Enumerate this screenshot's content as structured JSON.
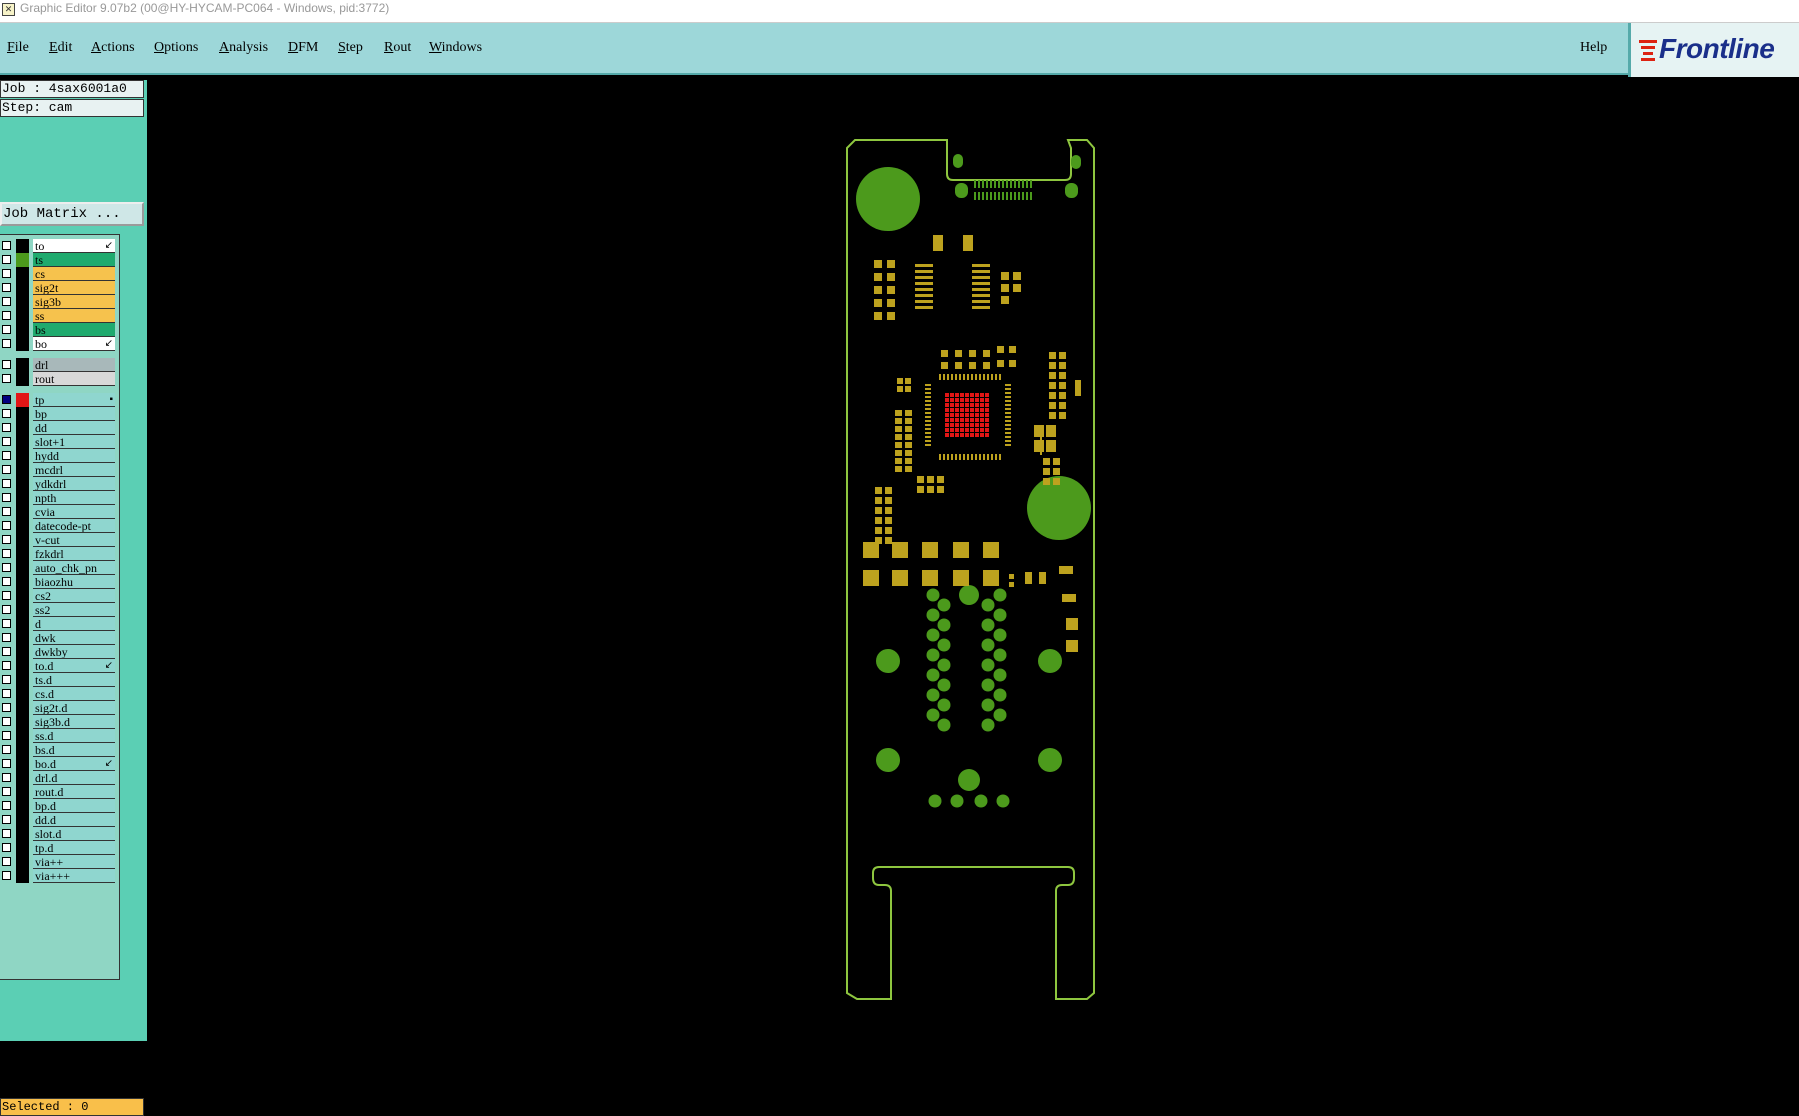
{
  "window": {
    "title": "Graphic Editor 9.07b2 (00@HY-HYCAM-PC064 - Windows, pid:3772)"
  },
  "menu": [
    {
      "label": "File",
      "u": "F",
      "rest": "ile"
    },
    {
      "label": "Edit",
      "u": "E",
      "rest": "dit"
    },
    {
      "label": "Actions",
      "u": "A",
      "rest": "ctions"
    },
    {
      "label": "Options",
      "u": "O",
      "rest": "ptions"
    },
    {
      "label": "Analysis",
      "u": "A",
      "rest": "nalysis"
    },
    {
      "label": "DFM",
      "u": "D",
      "rest": "FM"
    },
    {
      "label": "Step",
      "u": "S",
      "rest": "tep"
    },
    {
      "label": "Rout",
      "u": "R",
      "rest": "out"
    },
    {
      "label": "Windows",
      "u": "W",
      "rest": "indows"
    }
  ],
  "help": "Help",
  "logo": "Frontline",
  "info": {
    "job": "Job : 4sax6001a0",
    "step": "Step: cam"
  },
  "job_matrix_button": "Job Matrix ...",
  "selected": "Selected : 0",
  "colors": {
    "menu_bg": "#9dd7d9",
    "panel_bg": "#5bcfb4",
    "board_outline": "#8ec63f",
    "copper_green": "#4c9a1c",
    "pad_gold": "#bda21e",
    "red_layer": "#e21616"
  },
  "layers": [
    {
      "name": "to",
      "bg": "#ffffff",
      "swatch": "#000000",
      "mark": "↙"
    },
    {
      "name": "ts",
      "bg": "#1faa6e",
      "swatch": "#4c9a1c",
      "mark": ""
    },
    {
      "name": "cs",
      "bg": "#f6c24d",
      "swatch": "#000000",
      "mark": ""
    },
    {
      "name": "sig2t",
      "bg": "#f6c24d",
      "swatch": "#000000",
      "mark": ""
    },
    {
      "name": "sig3b",
      "bg": "#f6c24d",
      "swatch": "#000000",
      "mark": ""
    },
    {
      "name": "ss",
      "bg": "#f6c24d",
      "swatch": "#000000",
      "mark": ""
    },
    {
      "name": "bs",
      "bg": "#1faa6e",
      "swatch": "#000000",
      "mark": ""
    },
    {
      "name": "bo",
      "bg": "#ffffff",
      "swatch": "#000000",
      "mark": "↙"
    },
    {
      "name": "drl",
      "bg": "#a8b8ba",
      "swatch": "#000000",
      "mark": ""
    },
    {
      "name": "rout",
      "bg": "#d8d8d8",
      "swatch": "#000000",
      "mark": ""
    },
    {
      "name": "tp",
      "bg": "#8fd6cf",
      "swatch": "#e21616",
      "mark": "▪",
      "checked": true
    },
    {
      "name": "bp",
      "bg": "#8fd6cf",
      "swatch": "#000000",
      "mark": ""
    },
    {
      "name": "dd",
      "bg": "#8fd6cf",
      "swatch": "#000000",
      "mark": ""
    },
    {
      "name": "slot+1",
      "bg": "#8fd6cf",
      "swatch": "#000000",
      "mark": ""
    },
    {
      "name": "hydd",
      "bg": "#8fd6cf",
      "swatch": "#000000",
      "mark": ""
    },
    {
      "name": "mcdrl",
      "bg": "#8fd6cf",
      "swatch": "#000000",
      "mark": ""
    },
    {
      "name": "ydkdrl",
      "bg": "#8fd6cf",
      "swatch": "#000000",
      "mark": ""
    },
    {
      "name": "npth",
      "bg": "#8fd6cf",
      "swatch": "#000000",
      "mark": ""
    },
    {
      "name": "cvia",
      "bg": "#8fd6cf",
      "swatch": "#000000",
      "mark": ""
    },
    {
      "name": "datecode-pt",
      "bg": "#8fd6cf",
      "swatch": "#000000",
      "mark": ""
    },
    {
      "name": "v-cut",
      "bg": "#8fd6cf",
      "swatch": "#000000",
      "mark": ""
    },
    {
      "name": "fzkdrl",
      "bg": "#8fd6cf",
      "swatch": "#000000",
      "mark": ""
    },
    {
      "name": "auto_chk_pn",
      "bg": "#8fd6cf",
      "swatch": "#000000",
      "mark": ""
    },
    {
      "name": "biaozhu",
      "bg": "#8fd6cf",
      "swatch": "#000000",
      "mark": ""
    },
    {
      "name": "cs2",
      "bg": "#8fd6cf",
      "swatch": "#000000",
      "mark": ""
    },
    {
      "name": "ss2",
      "bg": "#8fd6cf",
      "swatch": "#000000",
      "mark": ""
    },
    {
      "name": "d",
      "bg": "#8fd6cf",
      "swatch": "#000000",
      "mark": ""
    },
    {
      "name": "dwk",
      "bg": "#8fd6cf",
      "swatch": "#000000",
      "mark": ""
    },
    {
      "name": "dwkby",
      "bg": "#8fd6cf",
      "swatch": "#000000",
      "mark": ""
    },
    {
      "name": "to.d",
      "bg": "#8fd6cf",
      "swatch": "#000000",
      "mark": "↙"
    },
    {
      "name": "ts.d",
      "bg": "#8fd6cf",
      "swatch": "#000000",
      "mark": ""
    },
    {
      "name": "cs.d",
      "bg": "#8fd6cf",
      "swatch": "#000000",
      "mark": ""
    },
    {
      "name": "sig2t.d",
      "bg": "#8fd6cf",
      "swatch": "#000000",
      "mark": ""
    },
    {
      "name": "sig3b.d",
      "bg": "#8fd6cf",
      "swatch": "#000000",
      "mark": ""
    },
    {
      "name": "ss.d",
      "bg": "#8fd6cf",
      "swatch": "#000000",
      "mark": ""
    },
    {
      "name": "bs.d",
      "bg": "#8fd6cf",
      "swatch": "#000000",
      "mark": ""
    },
    {
      "name": "bo.d",
      "bg": "#8fd6cf",
      "swatch": "#000000",
      "mark": "↙"
    },
    {
      "name": "drl.d",
      "bg": "#8fd6cf",
      "swatch": "#000000",
      "mark": ""
    },
    {
      "name": "rout.d",
      "bg": "#8fd6cf",
      "swatch": "#000000",
      "mark": ""
    },
    {
      "name": "bp.d",
      "bg": "#8fd6cf",
      "swatch": "#000000",
      "mark": ""
    },
    {
      "name": "dd.d",
      "bg": "#8fd6cf",
      "swatch": "#000000",
      "mark": ""
    },
    {
      "name": "slot.d",
      "bg": "#8fd6cf",
      "swatch": "#000000",
      "mark": ""
    },
    {
      "name": "tp.d",
      "bg": "#8fd6cf",
      "swatch": "#000000",
      "mark": ""
    },
    {
      "name": "via++",
      "bg": "#8fd6cf",
      "swatch": "#000000",
      "mark": ""
    },
    {
      "name": "via+++",
      "bg": "#8fd6cf",
      "swatch": "#000000",
      "mark": ""
    }
  ]
}
